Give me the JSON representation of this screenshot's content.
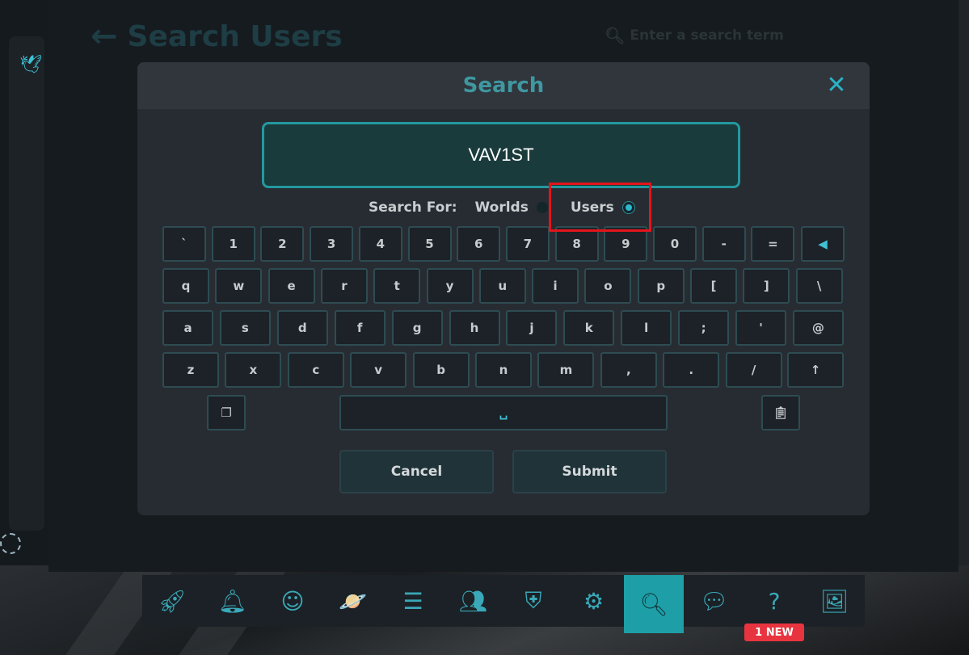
{
  "background": {
    "page_title": "Search Users",
    "search_placeholder": "Enter a search term"
  },
  "dialog": {
    "title": "Search",
    "query": "VAV1ST",
    "search_for_label": "Search For:",
    "options": [
      {
        "label": "Worlds",
        "selected": false
      },
      {
        "label": "Users",
        "selected": true
      }
    ],
    "cancel_label": "Cancel",
    "submit_label": "Submit"
  },
  "keyboard": {
    "row1": [
      "`",
      "1",
      "2",
      "3",
      "4",
      "5",
      "6",
      "7",
      "8",
      "9",
      "0",
      "-",
      "="
    ],
    "row2": [
      "q",
      "w",
      "e",
      "r",
      "t",
      "y",
      "u",
      "i",
      "o",
      "p",
      "[",
      "]",
      "\\"
    ],
    "row3": [
      "a",
      "s",
      "d",
      "f",
      "g",
      "h",
      "j",
      "k",
      "l",
      ";",
      "'",
      "@"
    ],
    "row4": [
      "z",
      "x",
      "c",
      "v",
      "b",
      "n",
      "m",
      ",",
      ".",
      "/"
    ]
  },
  "dock": {
    "items": [
      "rocket-icon",
      "bell-icon",
      "profile-icon",
      "worlds-icon",
      "social-icon",
      "friends-icon",
      "safety-icon",
      "settings-icon",
      "search-icon",
      "chat-icon",
      "help-icon",
      "gallery-icon"
    ],
    "active": "search-icon",
    "help_badge": "1 NEW"
  },
  "colors": {
    "accent": "#2ab2c5",
    "highlight_box": "#e4141b",
    "badge": "#e8343f"
  }
}
